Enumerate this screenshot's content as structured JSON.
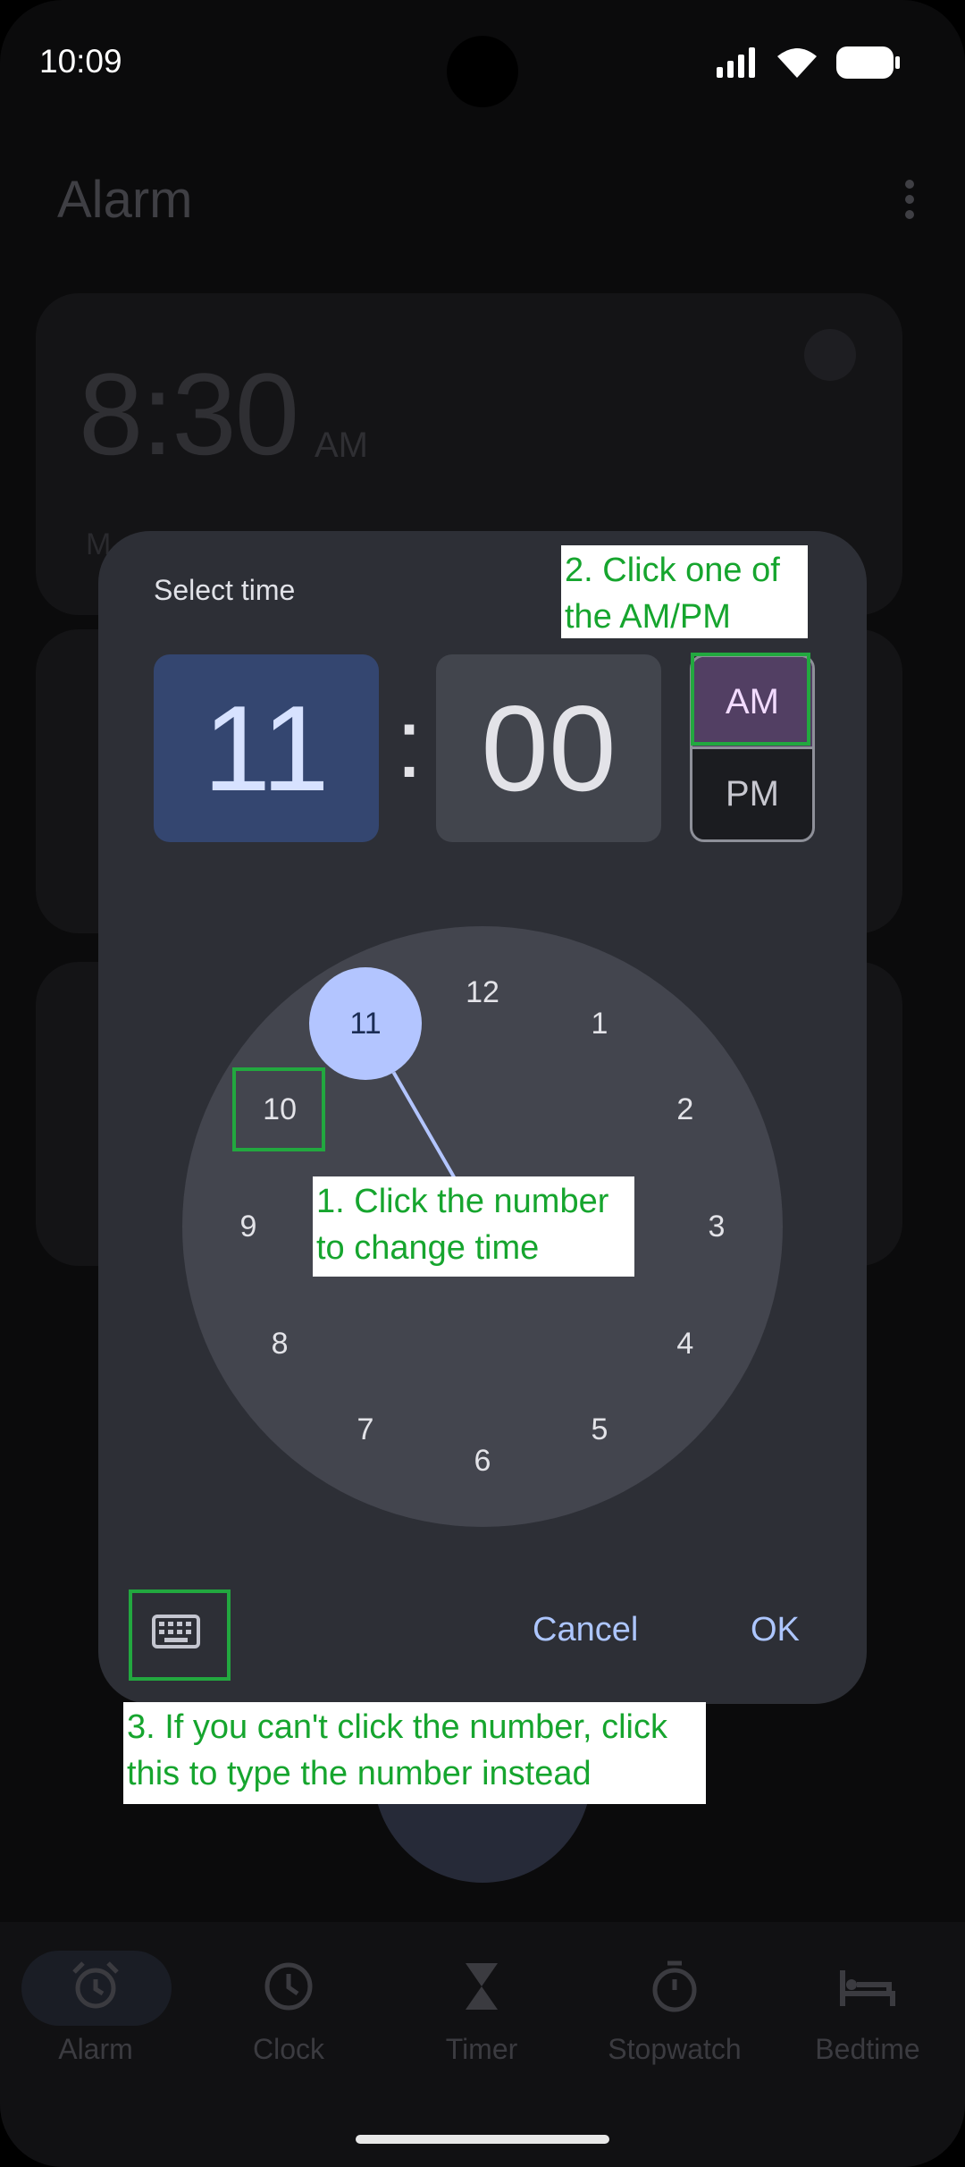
{
  "status_bar": {
    "time": "10:09"
  },
  "app": {
    "title": "Alarm"
  },
  "background_alarm": {
    "time": "8:30",
    "ampm": "AM",
    "schedule_hint": "M"
  },
  "dialog": {
    "title": "Select time",
    "hour": "11",
    "separator": ":",
    "minute": "00",
    "am_label": "AM",
    "pm_label": "PM",
    "selected_period": "AM",
    "clock_numbers": [
      "12",
      "1",
      "2",
      "3",
      "4",
      "5",
      "6",
      "7",
      "8",
      "9",
      "10",
      "11"
    ],
    "selected_number": "11",
    "cancel_label": "Cancel",
    "ok_label": "OK",
    "keyboard_icon": "keyboard-icon"
  },
  "annotations": {
    "note1": "1. Click the number to change time",
    "note2": "2. Click one of the AM/PM",
    "note3": "3. If you can't click the number, click this to type the number instead",
    "color": "#22a83f"
  },
  "bottom_nav": {
    "items": [
      {
        "label": "Alarm",
        "icon": "alarm-icon",
        "active": true
      },
      {
        "label": "Clock",
        "icon": "clock-icon",
        "active": false
      },
      {
        "label": "Timer",
        "icon": "hourglass-icon",
        "active": false
      },
      {
        "label": "Stopwatch",
        "icon": "stopwatch-icon",
        "active": false
      },
      {
        "label": "Bedtime",
        "icon": "bed-icon",
        "active": false
      }
    ]
  },
  "colors": {
    "dialog_bg": "#2d2f36",
    "hour_selected": "#344670",
    "am_selected": "#523f63",
    "accent": "#b3c5ff",
    "button_text": "#adc6ff"
  }
}
